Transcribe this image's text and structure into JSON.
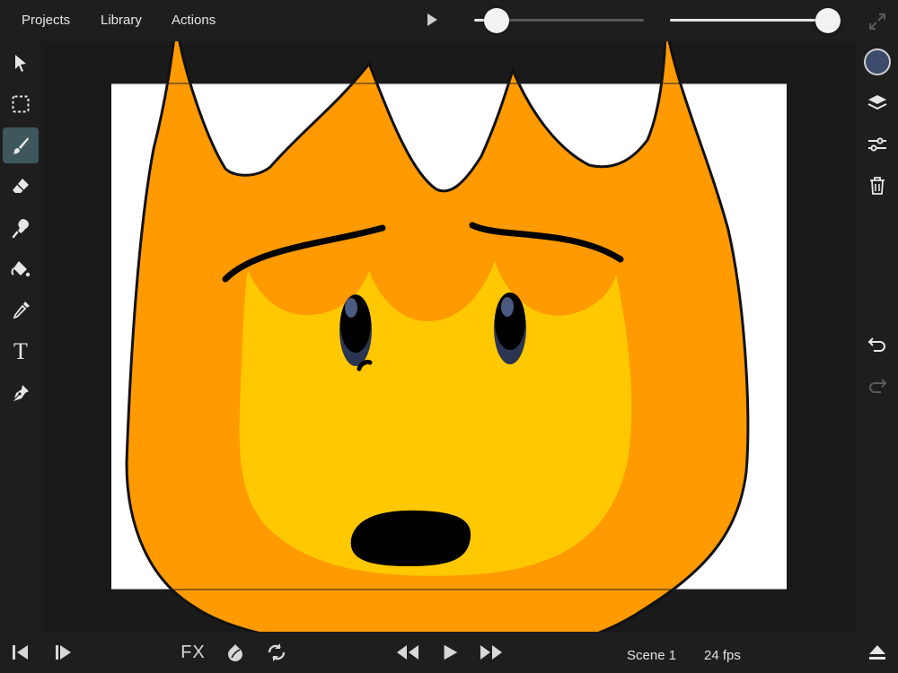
{
  "menu": {
    "projects": "Projects",
    "library": "Library",
    "actions": "Actions"
  },
  "playback_slider": {
    "value": 0.14
  },
  "size_slider": {
    "value": 1.0
  },
  "left_tools": [
    {
      "name": "select-tool",
      "icon": "arrow-cursor-icon"
    },
    {
      "name": "marquee-tool",
      "icon": "dashed-square-icon"
    },
    {
      "name": "brush-tool",
      "icon": "brush-icon",
      "active": true
    },
    {
      "name": "eraser-tool",
      "icon": "eraser-icon"
    },
    {
      "name": "smudge-tool",
      "icon": "smudge-icon"
    },
    {
      "name": "fill-tool",
      "icon": "paint-bucket-icon"
    },
    {
      "name": "eyedropper-tool",
      "icon": "eyedropper-icon"
    },
    {
      "name": "text-tool",
      "icon": "text-icon",
      "label": "T"
    },
    {
      "name": "pen-tool",
      "icon": "pen-nib-icon"
    }
  ],
  "right_tools": {
    "color": "#3c4a6b",
    "icons": [
      "layers-icon",
      "sliders-icon",
      "trash-icon",
      "undo-icon",
      "redo-icon"
    ]
  },
  "bottom": {
    "fx_label": "FX",
    "scene": "Scene 1",
    "fps": "24 fps"
  },
  "colors": {
    "accent_active": "#3e575c",
    "flame_outer": "#ff9a00",
    "flame_inner": "#ffc800",
    "eye": "#2b3450"
  }
}
